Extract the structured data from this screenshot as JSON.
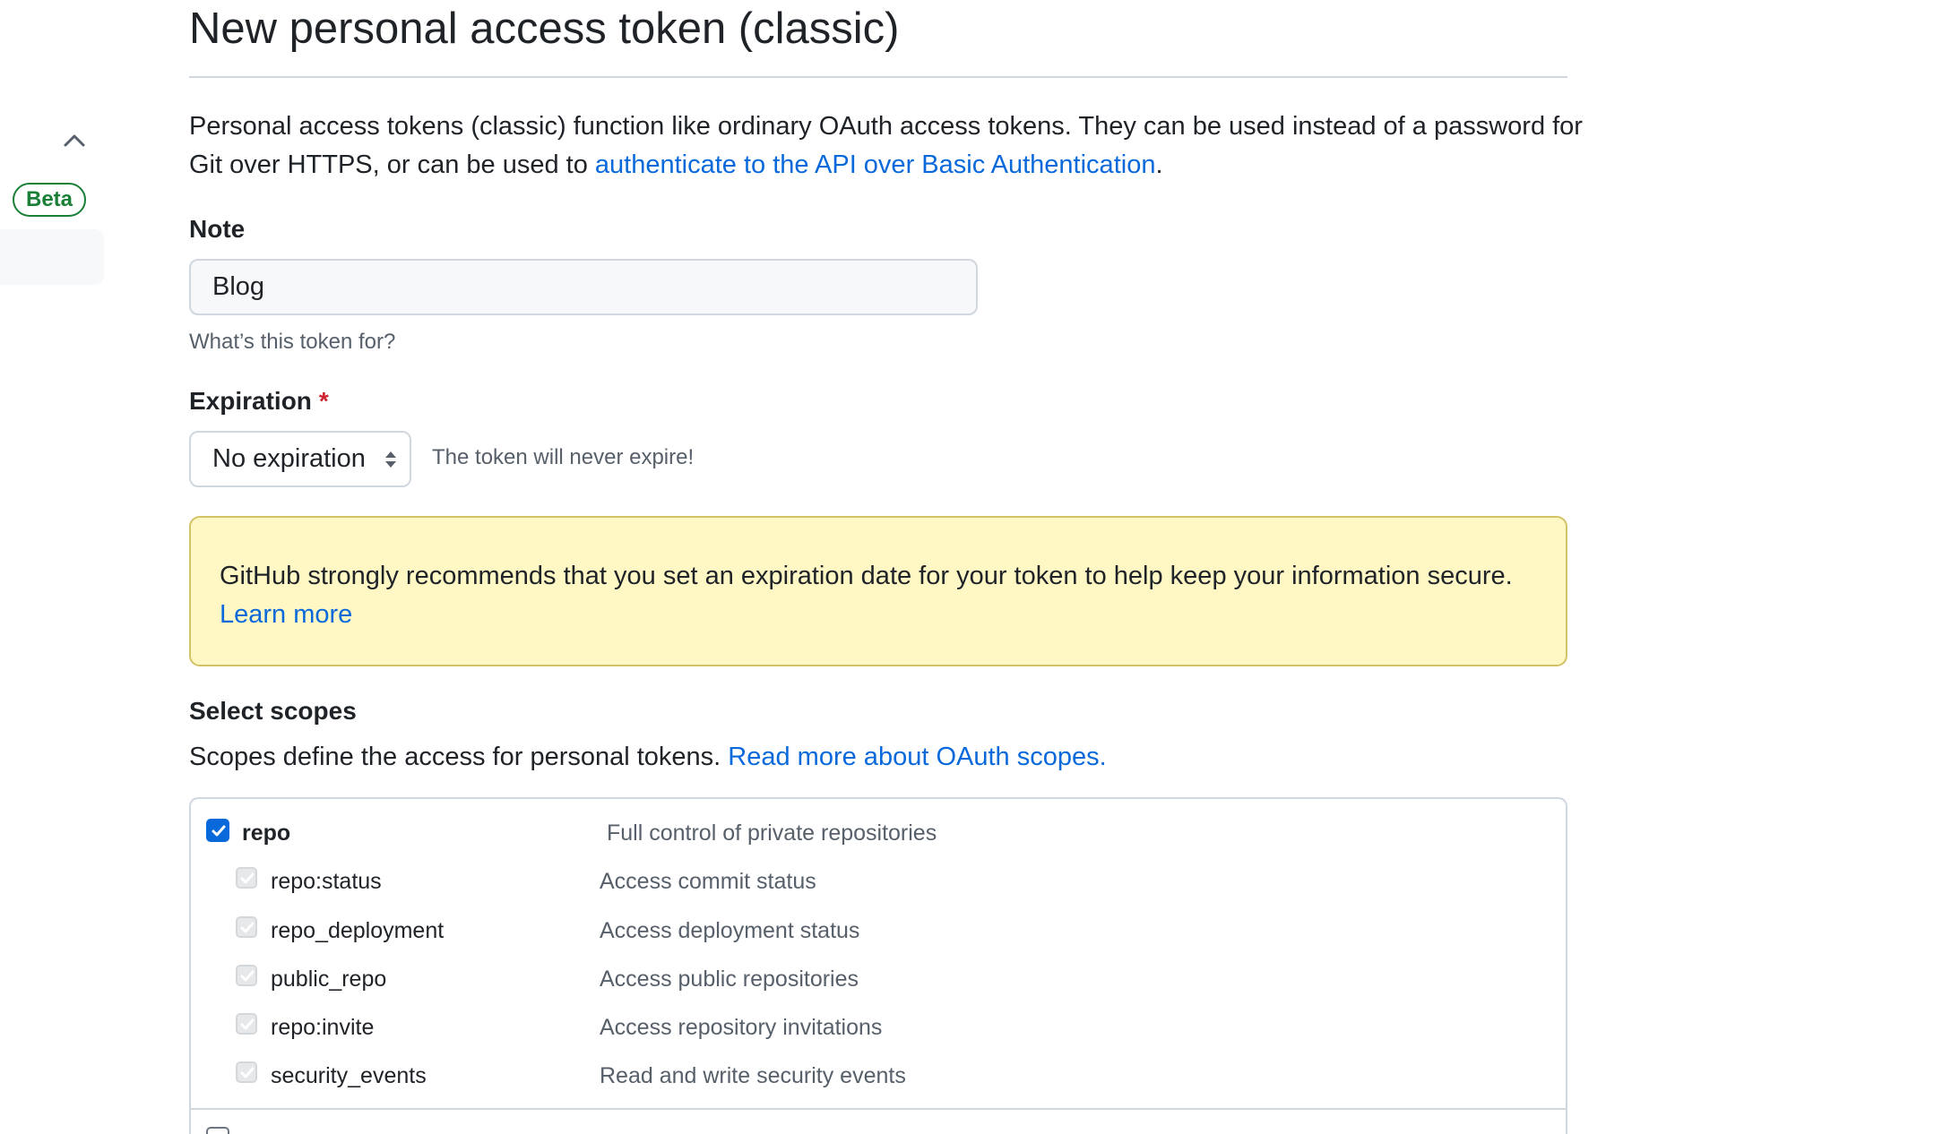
{
  "page": {
    "title": "New personal access token (classic)",
    "intro_text": "Personal access tokens (classic) function like ordinary OAuth access tokens. They can be used instead of a password for Git over HTTPS, or can be used to ",
    "intro_link": "authenticate to the API over Basic Authentication",
    "intro_end": "."
  },
  "sidebar": {
    "collapse_icon": "chevron-up-icon",
    "beta_label": "Beta"
  },
  "note": {
    "label": "Note",
    "value": "Blog",
    "hint": "What’s this token for?"
  },
  "expiration": {
    "label": "Expiration",
    "required_mark": "*",
    "selected": "No expiration",
    "note": "The token will never expire!"
  },
  "flash": {
    "message": "GitHub strongly recommends that you set an expiration date for your token to help keep your information secure.",
    "link": "Learn more"
  },
  "scopes": {
    "heading": "Select scopes",
    "description": "Scopes define the access for personal tokens. ",
    "link": "Read more about OAuth scopes.",
    "items": [
      {
        "name": "repo",
        "description": "Full control of private repositories",
        "checked": true
      },
      {
        "name": "repo:status",
        "description": "Access commit status",
        "checked": true
      },
      {
        "name": "repo_deployment",
        "description": "Access deployment status",
        "checked": true
      },
      {
        "name": "public_repo",
        "description": "Access public repositories",
        "checked": true
      },
      {
        "name": "repo:invite",
        "description": "Access repository invitations",
        "checked": true
      },
      {
        "name": "security_events",
        "description": "Read and write security events",
        "checked": true
      }
    ]
  },
  "colors": {
    "link": "#0969da",
    "beta_green": "#1a7f37",
    "required_red": "#cf222e",
    "flash_bg": "#fff8c5",
    "checkbox_blue": "#0969da"
  }
}
